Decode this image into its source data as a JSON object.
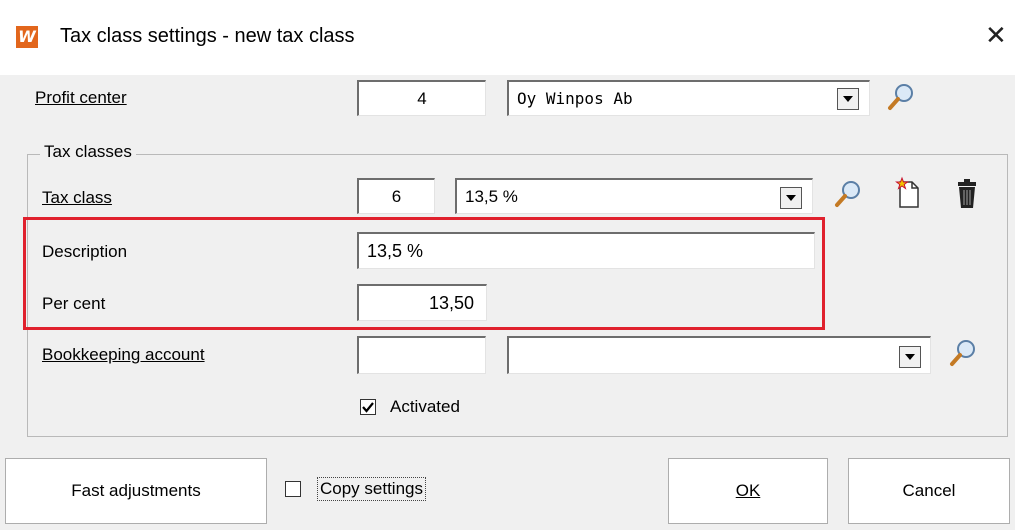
{
  "window": {
    "title": "Tax class settings - new tax class",
    "logo_text": "W",
    "close_glyph": "✕"
  },
  "profit_center": {
    "label": "Profit center",
    "code": "4",
    "selected": "Oy Winpos Ab"
  },
  "tax_classes_group": {
    "label": "Tax classes"
  },
  "tax_class": {
    "label": "Tax class",
    "code": "6",
    "selected": "13,5 %"
  },
  "description": {
    "label": "Description",
    "value": "13,5 %"
  },
  "per_cent": {
    "label": "Per cent",
    "value": "13,50"
  },
  "bookkeeping": {
    "label": "Bookkeeping account",
    "code": "",
    "selected": ""
  },
  "activated": {
    "label": "Activated",
    "checked": true
  },
  "buttons": {
    "fast_adjustments": "Fast adjustments",
    "copy_settings": "Copy settings",
    "ok": "OK",
    "cancel": "Cancel"
  },
  "copy_settings_checked": false,
  "colors": {
    "highlight_box": "#e0212d",
    "logo_bg": "#e2661c",
    "dialog_bg": "#f0f0f0"
  },
  "icons": [
    "search-icon",
    "new-document-icon",
    "trash-icon",
    "chevron-down-icon",
    "checkmark-icon",
    "close-icon"
  ]
}
